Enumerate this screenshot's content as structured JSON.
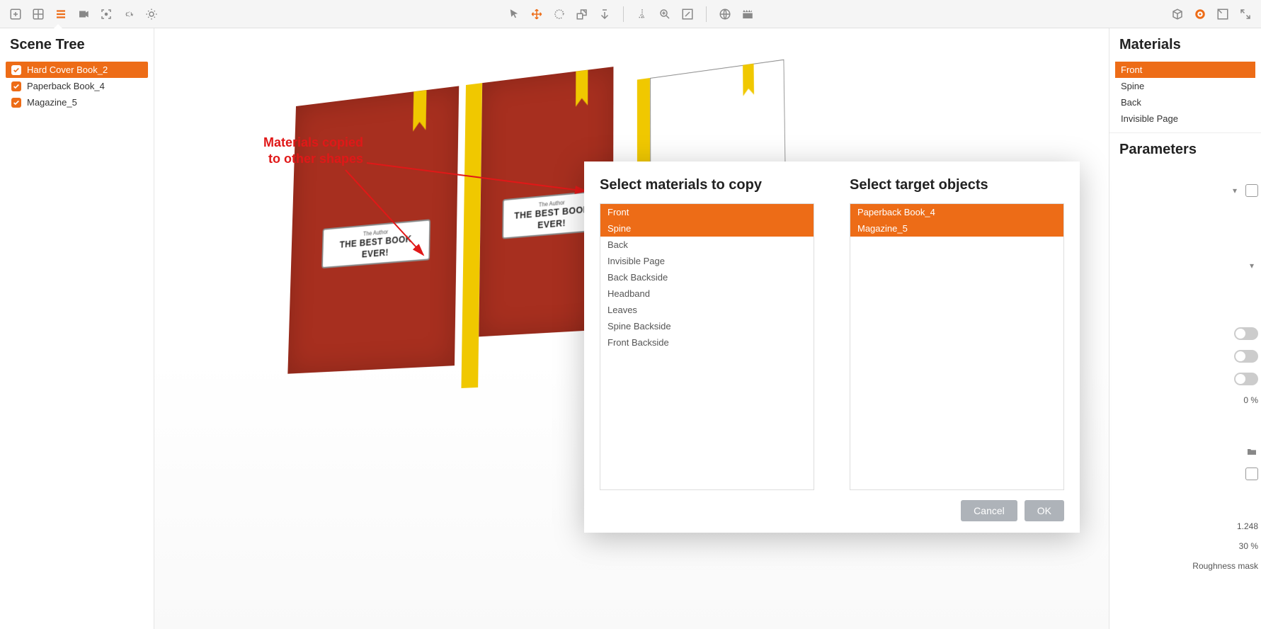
{
  "left_panel": {
    "title": "Scene Tree",
    "items": [
      {
        "label": "Hard Cover Book_2",
        "selected": true
      },
      {
        "label": "Paperback Book_4",
        "selected": false
      },
      {
        "label": "Magazine_5",
        "selected": false
      }
    ]
  },
  "right_panel": {
    "materials_title": "Materials",
    "materials": [
      {
        "label": "Front",
        "selected": true
      },
      {
        "label": "Spine",
        "selected": false
      },
      {
        "label": "Back",
        "selected": false
      },
      {
        "label": "Invisible Page",
        "selected": false
      }
    ],
    "parameters_title": "Parameters",
    "values": {
      "pct0": "0 %",
      "num1": "1.248",
      "pct30": "30 %",
      "roughness_label": "Roughness mask"
    }
  },
  "dialog": {
    "left_title": "Select materials to copy",
    "right_title": "Select target objects",
    "materials": [
      {
        "label": "Front",
        "selected": true
      },
      {
        "label": "Spine",
        "selected": true
      },
      {
        "label": "Back",
        "selected": false
      },
      {
        "label": "Invisible Page",
        "selected": false
      },
      {
        "label": "Back Backside",
        "selected": false
      },
      {
        "label": "Headband",
        "selected": false
      },
      {
        "label": "Leaves",
        "selected": false
      },
      {
        "label": "Spine Backside",
        "selected": false
      },
      {
        "label": "Front Backside",
        "selected": false
      }
    ],
    "targets": [
      {
        "label": "Paperback Book_4",
        "selected": true
      },
      {
        "label": "Magazine_5",
        "selected": true
      }
    ],
    "cancel": "Cancel",
    "ok": "OK"
  },
  "annotation": {
    "line1": "Materials copied",
    "line2": "to other shapes"
  },
  "book_label": {
    "author": "The Author",
    "title1": "THE BEST BOOK",
    "title2": "EVER!"
  }
}
